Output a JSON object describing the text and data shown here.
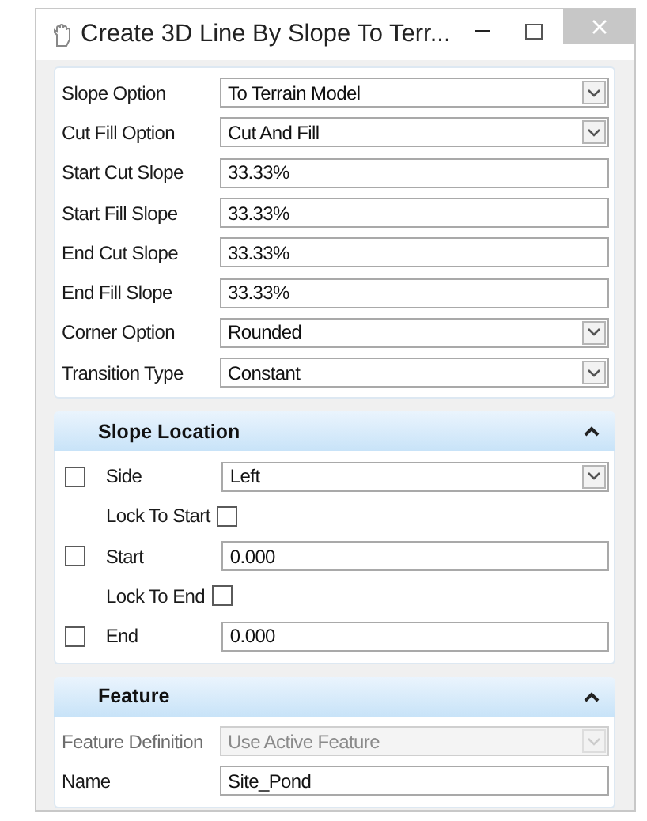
{
  "window": {
    "title": "Create 3D Line By Slope To Terr..."
  },
  "fields": [
    {
      "label": "Slope Option",
      "kind": "dropdown",
      "value": "To Terrain Model"
    },
    {
      "label": "Cut Fill Option",
      "kind": "dropdown",
      "value": "Cut And Fill"
    },
    {
      "label": "Start Cut Slope",
      "kind": "text",
      "value": "33.33%"
    },
    {
      "label": "Start Fill Slope",
      "kind": "text",
      "value": "33.33%"
    },
    {
      "label": "End Cut Slope",
      "kind": "text",
      "value": "33.33%"
    },
    {
      "label": "End Fill Slope",
      "kind": "text",
      "value": "33.33%"
    },
    {
      "label": "Corner Option",
      "kind": "dropdown",
      "value": "Rounded"
    },
    {
      "label": "Transition Type",
      "kind": "dropdown",
      "value": "Constant"
    }
  ],
  "sections": [
    {
      "title": "Slope Location",
      "expanded": true,
      "rows": [
        {
          "kind": "dropdown",
          "label": "Side",
          "checked": false,
          "value": "Left"
        },
        {
          "kind": "lock",
          "label": "Lock To Start",
          "checked": false
        },
        {
          "kind": "text",
          "label": "Start",
          "checked": false,
          "value": "0.000"
        },
        {
          "kind": "lock",
          "label": "Lock To End",
          "checked": false
        },
        {
          "kind": "text",
          "label": "End",
          "checked": false,
          "value": "0.000"
        }
      ]
    },
    {
      "title": "Feature",
      "expanded": true,
      "rows": [
        {
          "kind": "dropdown",
          "label": "Feature Definition",
          "disabled": true,
          "value": "Use Active Feature"
        },
        {
          "kind": "text",
          "label": "Name",
          "disabled": false,
          "value": "Site_Pond"
        }
      ]
    }
  ]
}
